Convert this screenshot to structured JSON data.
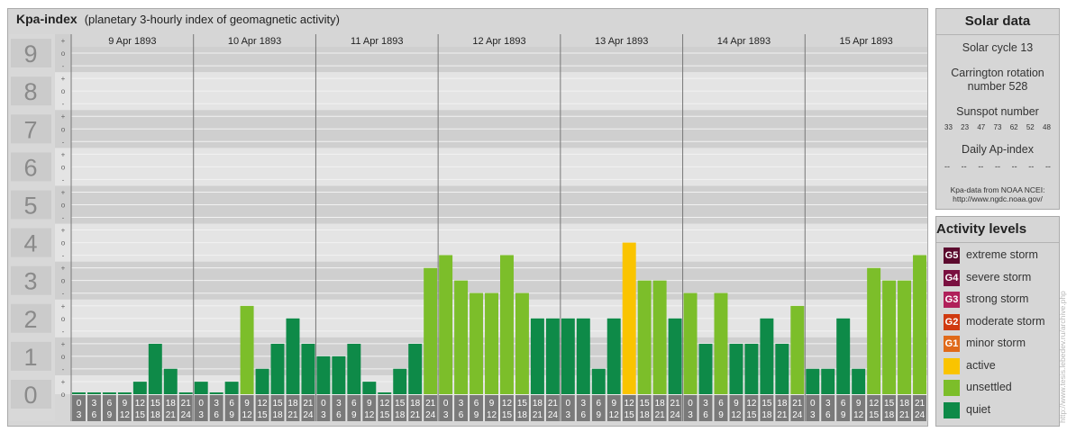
{
  "header": {
    "title": "Kpa-index",
    "subtitle": "(planetary 3-hourly index of geomagnetic activity)"
  },
  "solar": {
    "title": "Solar data",
    "solar_cycle": "Solar cycle 13",
    "carrington_line1": "Carrington rotation",
    "carrington_line2": "number 528",
    "sunspot_label": "Sunspot number",
    "sunspot_values": [
      "33",
      "23",
      "47",
      "73",
      "62",
      "52",
      "48"
    ],
    "ap_label": "Daily Ap-index",
    "ap_values": [
      "--",
      "--",
      "--",
      "--",
      "--",
      "--",
      "--"
    ],
    "source_line1": "Kpa-data from NOAA NCEI:",
    "source_line2": "http://www.ngdc.noaa.gov/"
  },
  "activity": {
    "title": "Activity levels",
    "levels": [
      {
        "code": "G5",
        "label": "extreme storm",
        "color": "#5c0a2e"
      },
      {
        "code": "G4",
        "label": "severe storm",
        "color": "#7a1040"
      },
      {
        "code": "G3",
        "label": "strong storm",
        "color": "#b0205a"
      },
      {
        "code": "G2",
        "label": "moderate storm",
        "color": "#d03a10"
      },
      {
        "code": "G1",
        "label": "minor storm",
        "color": "#e06a1a"
      },
      {
        "code": "",
        "label": "active",
        "color": "#fac400"
      },
      {
        "code": "",
        "label": "unsettled",
        "color": "#7cbe2a"
      },
      {
        "code": "",
        "label": "quiet",
        "color": "#0e8a48"
      }
    ]
  },
  "watermark": "http://www.tesis.lebedev.ru/archive.php",
  "chart_data": {
    "type": "bar",
    "title": "Kpa-index",
    "subtitle": "(planetary 3-hourly index of geomagnetic activity)",
    "ylim": [
      0,
      9
    ],
    "y_ticks": [
      "0",
      "1",
      "2",
      "3",
      "4",
      "5",
      "6",
      "7",
      "8",
      "9"
    ],
    "y_minor": [
      "-",
      "o",
      "+"
    ],
    "days": [
      "9 Apr 1893",
      "10 Apr 1893",
      "11 Apr 1893",
      "12 Apr 1893",
      "13 Apr 1893",
      "14 Apr 1893",
      "15 Apr 1893"
    ],
    "interval_start": [
      "0",
      "3",
      "6",
      "9",
      "12",
      "15",
      "18",
      "21"
    ],
    "interval_end": [
      "3",
      "6",
      "9",
      "12",
      "15",
      "18",
      "21",
      "24"
    ],
    "values": [
      [
        0,
        0,
        0,
        0,
        0.33,
        1.33,
        0.67,
        0
      ],
      [
        0.33,
        0,
        0.33,
        2.33,
        0.67,
        1.33,
        2,
        1.33
      ],
      [
        1,
        1,
        1.33,
        0.33,
        0,
        0.67,
        1.33,
        3.33
      ],
      [
        3.67,
        3,
        2.67,
        2.67,
        3.67,
        2.67,
        2,
        2
      ],
      [
        2,
        2,
        0.67,
        2,
        4,
        3,
        3,
        2
      ],
      [
        2.67,
        1.33,
        2.67,
        1.33,
        1.33,
        2,
        1.33,
        2.33
      ],
      [
        0.67,
        0.67,
        2,
        0.67,
        3.33,
        3,
        3,
        3.67
      ]
    ],
    "levels": {
      "quiet": {
        "max": 2,
        "color": "#0e8a48"
      },
      "unsettled": {
        "max": 3.67,
        "color": "#7cbe2a"
      },
      "active": {
        "max": 4.67,
        "color": "#fac400"
      }
    },
    "grid": true
  }
}
